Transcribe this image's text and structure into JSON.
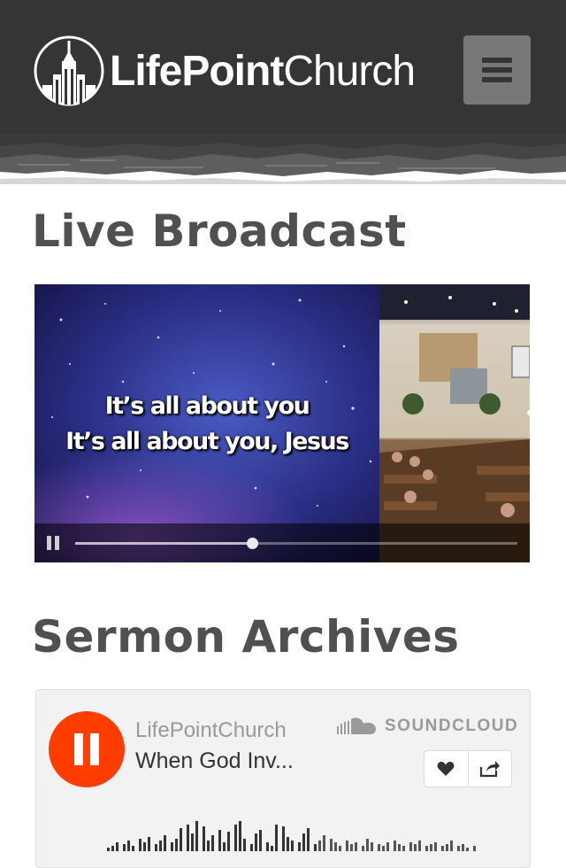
{
  "header": {
    "brand_bold": "LifePoint",
    "brand_light": "Church",
    "colors": {
      "background": "#353535",
      "menu_button": "#777777"
    },
    "icons": {
      "logo": "church-building-logo",
      "menu": "hamburger-icon"
    }
  },
  "live": {
    "title": "Live Broadcast",
    "lyric_line1": "It’s all about you",
    "lyric_line2": "It’s all about you, Jesus",
    "playback_progress": 0.4,
    "icons": {
      "pause": "pause-icon"
    }
  },
  "archives": {
    "title": "Sermon Archives",
    "player": {
      "user": "LifePointChurch",
      "track": "When God Inv...",
      "brand": "SOUNDCLOUD",
      "accent_color": "#ff3d00",
      "icons": {
        "play_state": "pause-icon",
        "brand": "soundcloud-cloud-icon",
        "like": "heart-icon",
        "share": "share-icon"
      }
    }
  }
}
